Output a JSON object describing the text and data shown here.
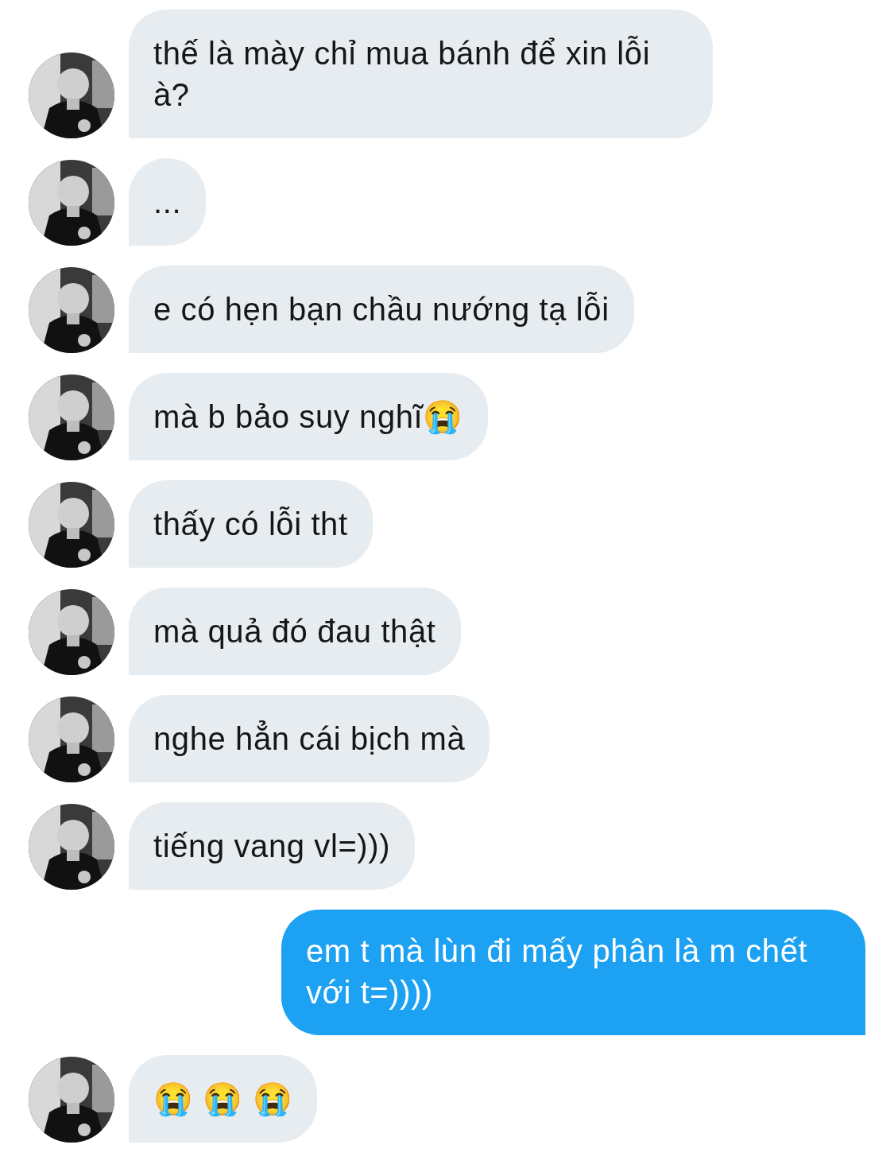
{
  "messages": [
    {
      "kind": "received",
      "text": "thế là mày chỉ mua bánh để xin lỗi à?"
    },
    {
      "kind": "received",
      "text": "..."
    },
    {
      "kind": "received",
      "text": "e có hẹn bạn chầu nướng tạ lỗi"
    },
    {
      "kind": "received",
      "text": "mà b bảo suy nghĩ😭"
    },
    {
      "kind": "received",
      "text": "thấy có lỗi tht"
    },
    {
      "kind": "received",
      "text": "mà quả đó đau thật"
    },
    {
      "kind": "received",
      "text": "nghe hẳn cái bịch mà"
    },
    {
      "kind": "received",
      "text": "tiếng vang vl=)))"
    },
    {
      "kind": "sent",
      "text": "em t mà lùn đi mấy phân là m chết với t=))))"
    },
    {
      "kind": "received",
      "text": "😭 😭 😭"
    }
  ]
}
